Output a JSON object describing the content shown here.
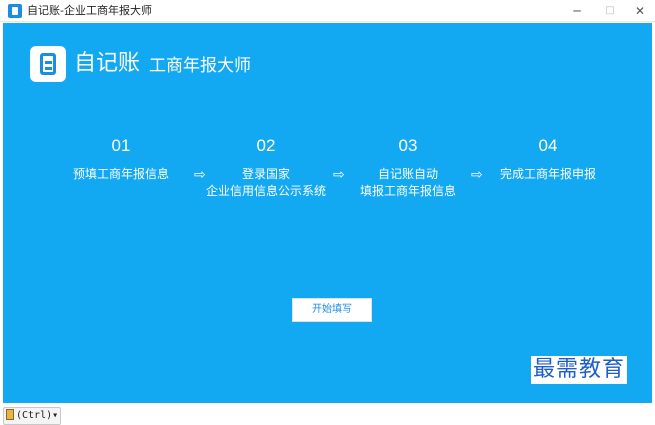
{
  "window": {
    "title": "自记账-企业工商年报大师",
    "controls": {
      "minimize": "─",
      "maximize": "□",
      "close": "✕"
    }
  },
  "header": {
    "brand": "自记账",
    "subtitle": "工商年报大师",
    "logo_icon": "notebook-icon"
  },
  "steps": [
    {
      "number": "01",
      "line1": "预填工商年报信息",
      "line2": ""
    },
    {
      "number": "02",
      "line1": "登录国家",
      "line2": "企业信用信息公示系统"
    },
    {
      "number": "03",
      "line1": "自记账自动",
      "line2": "填报工商年报信息"
    },
    {
      "number": "04",
      "line1": "完成工商年报申报",
      "line2": ""
    }
  ],
  "arrow_glyph": "⇨",
  "start_button": "开始填写",
  "watermark": "最需教育",
  "paste_options": "(Ctrl)▾",
  "colors": {
    "background": "#13a8f2",
    "accent": "#1a8fe0",
    "watermark": "#1f5ec8"
  }
}
